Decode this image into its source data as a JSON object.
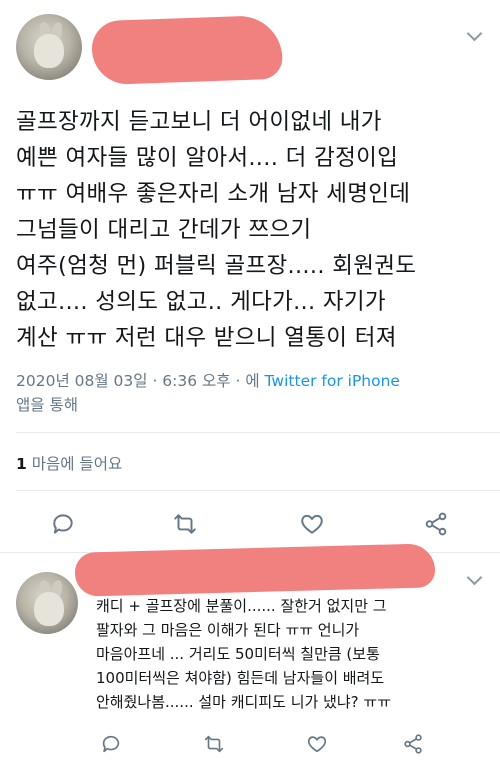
{
  "main_tweet": {
    "text_lines": [
      "골프장까지 듣고보니 더 어이없네 내가",
      "예쁜 여자들 많이 알아서.... 더 감정이입",
      "ㅠㅠ 여배우 좋은자리 소개 남자 세명인데",
      "그넘들이 대리고 간데가 쯔으기",
      "여주(엄청 먼) 퍼블릭 골프장..... 회원권도",
      "없고.... 성의도 없고.. 게다가... 자기가",
      "계산 ㅠㅠ  저런 대우 받으니 열통이 터져"
    ],
    "timestamp": "2020년 08월 03일 · 6:36 오후 · 에 ",
    "source": "Twitter for iPhone",
    "via": "앱을 통해",
    "likes_count": "1",
    "likes_label": " 마음에 들어요"
  },
  "reply_tweet": {
    "text_lines": [
      "캐디 + 골프장에 분풀이...... 잘한거 없지만 그",
      "팔자와 그 마음은 이해가 된다 ㅠㅠ 언니가",
      "마음아프네 ... 거리도 50미터씩 칠만큼 (보통",
      "100미터씩은 쳐야함) 힘든데 남자들이 배려도",
      "안해줬나봄...... 설마 캐디피도 니가 냈냐? ㅠㅠ"
    ]
  },
  "icons": {
    "reply": "reply-icon",
    "retweet": "retweet-icon",
    "like": "heart-icon",
    "share": "share-icon",
    "menu": "chevron-down-icon"
  },
  "colors": {
    "link": "#1b95e0",
    "muted": "#657786",
    "redaction": "#f07a78"
  }
}
